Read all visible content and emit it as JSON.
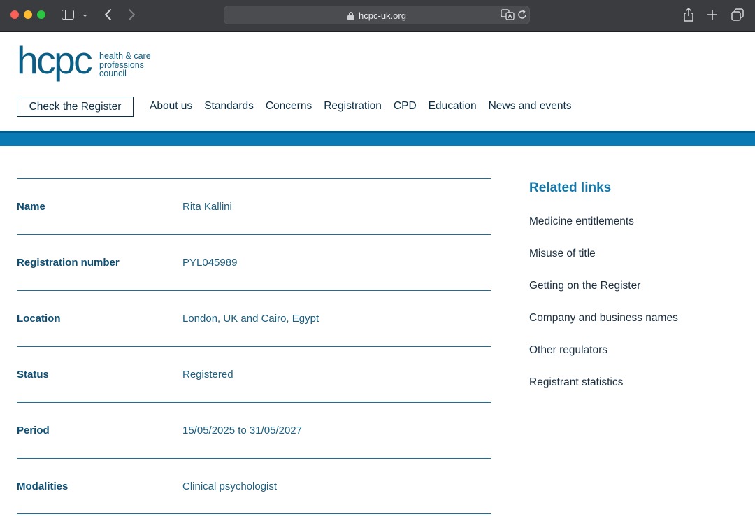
{
  "browser": {
    "url": "hcpc-uk.org"
  },
  "logo": {
    "mark": "hcpc",
    "line1": "health & care",
    "line2": "professions",
    "line3": "council"
  },
  "header": {
    "check_register_label": "Check the Register",
    "nav": [
      "About us",
      "Standards",
      "Concerns",
      "Registration",
      "CPD",
      "Education",
      "News and events"
    ]
  },
  "details": [
    {
      "label": "Name",
      "value": "Rita Kallini"
    },
    {
      "label": "Registration number",
      "value": "PYL045989"
    },
    {
      "label": "Location",
      "value": "London, UK and Cairo, Egypt"
    },
    {
      "label": "Status",
      "value": "Registered"
    },
    {
      "label": "Period",
      "value": "15/05/2025 to 31/05/2027"
    },
    {
      "label": "Modalities",
      "value": "Clinical psychologist"
    }
  ],
  "related": {
    "title": "Related links",
    "links": [
      "Medicine entitlements",
      "Misuse of title",
      "Getting on the Register",
      "Company and business names",
      "Other regulators",
      "Registrant statistics"
    ]
  },
  "colors": {
    "brand": "#0d5e85",
    "band": "#0a7ab5",
    "link_heading": "#1477a8"
  }
}
